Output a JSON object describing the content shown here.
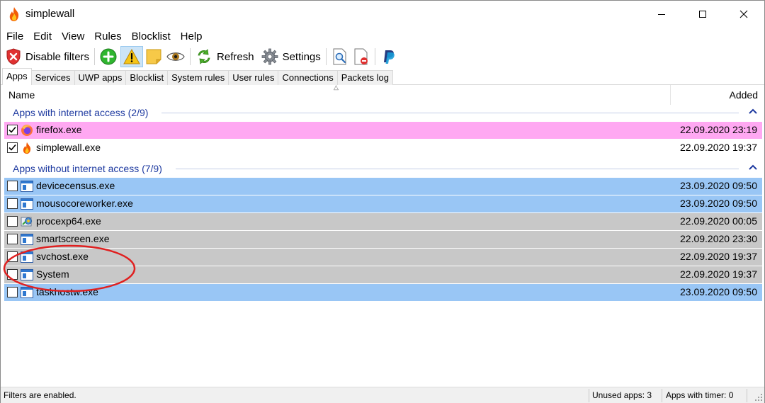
{
  "window": {
    "title": "simplewall"
  },
  "menu": [
    "File",
    "Edit",
    "View",
    "Rules",
    "Blocklist",
    "Help"
  ],
  "toolbar": {
    "disable_filters": "Disable filters",
    "refresh": "Refresh",
    "settings": "Settings"
  },
  "tabs": [
    "Apps",
    "Services",
    "UWP apps",
    "Blocklist",
    "System rules",
    "User rules",
    "Connections",
    "Packets log"
  ],
  "list": {
    "columns": {
      "name": "Name",
      "added": "Added"
    },
    "groups": [
      {
        "title": "Apps with internet access (2/9)",
        "rows": [
          {
            "name": "firefox.exe",
            "date": "22.09.2020 23:19",
            "checked": true,
            "bg": "#ffa8f2",
            "icon": "firefox-icon"
          },
          {
            "name": "simplewall.exe",
            "date": "22.09.2020 19:37",
            "checked": true,
            "bg": "#ffffff",
            "icon": "flame-icon"
          }
        ]
      },
      {
        "title": "Apps without internet access (7/9)",
        "rows": [
          {
            "name": "devicecensus.exe",
            "date": "23.09.2020 09:50",
            "checked": false,
            "bg": "#99c6f5",
            "icon": "app-window-icon"
          },
          {
            "name": "mousocoreworker.exe",
            "date": "23.09.2020 09:50",
            "checked": false,
            "bg": "#99c6f5",
            "icon": "app-window-icon"
          },
          {
            "name": "procexp64.exe",
            "date": "22.09.2020 00:05",
            "checked": false,
            "bg": "#c8c8c8",
            "icon": "procexp-icon"
          },
          {
            "name": "smartscreen.exe",
            "date": "22.09.2020 23:30",
            "checked": false,
            "bg": "#c8c8c8",
            "icon": "app-window-icon"
          },
          {
            "name": "svchost.exe",
            "date": "22.09.2020 19:37",
            "checked": false,
            "bg": "#c8c8c8",
            "icon": "app-window-icon"
          },
          {
            "name": "System",
            "date": "22.09.2020 19:37",
            "checked": false,
            "bg": "#c8c8c8",
            "icon": "app-window-icon"
          },
          {
            "name": "taskhostw.exe",
            "date": "23.09.2020 09:50",
            "checked": false,
            "bg": "#99c6f5",
            "icon": "app-window-icon"
          }
        ]
      }
    ]
  },
  "status": {
    "main": "Filters are enabled.",
    "unused": "Unused apps: 3",
    "timer": "Apps with timer: 0"
  },
  "colors": {
    "allowed_highlight": "#ffa8f2",
    "signed_blue": "#99c6f5",
    "system_gray": "#c8c8c8",
    "group_text": "#1e3aa0",
    "annotation_red": "#e02020"
  }
}
